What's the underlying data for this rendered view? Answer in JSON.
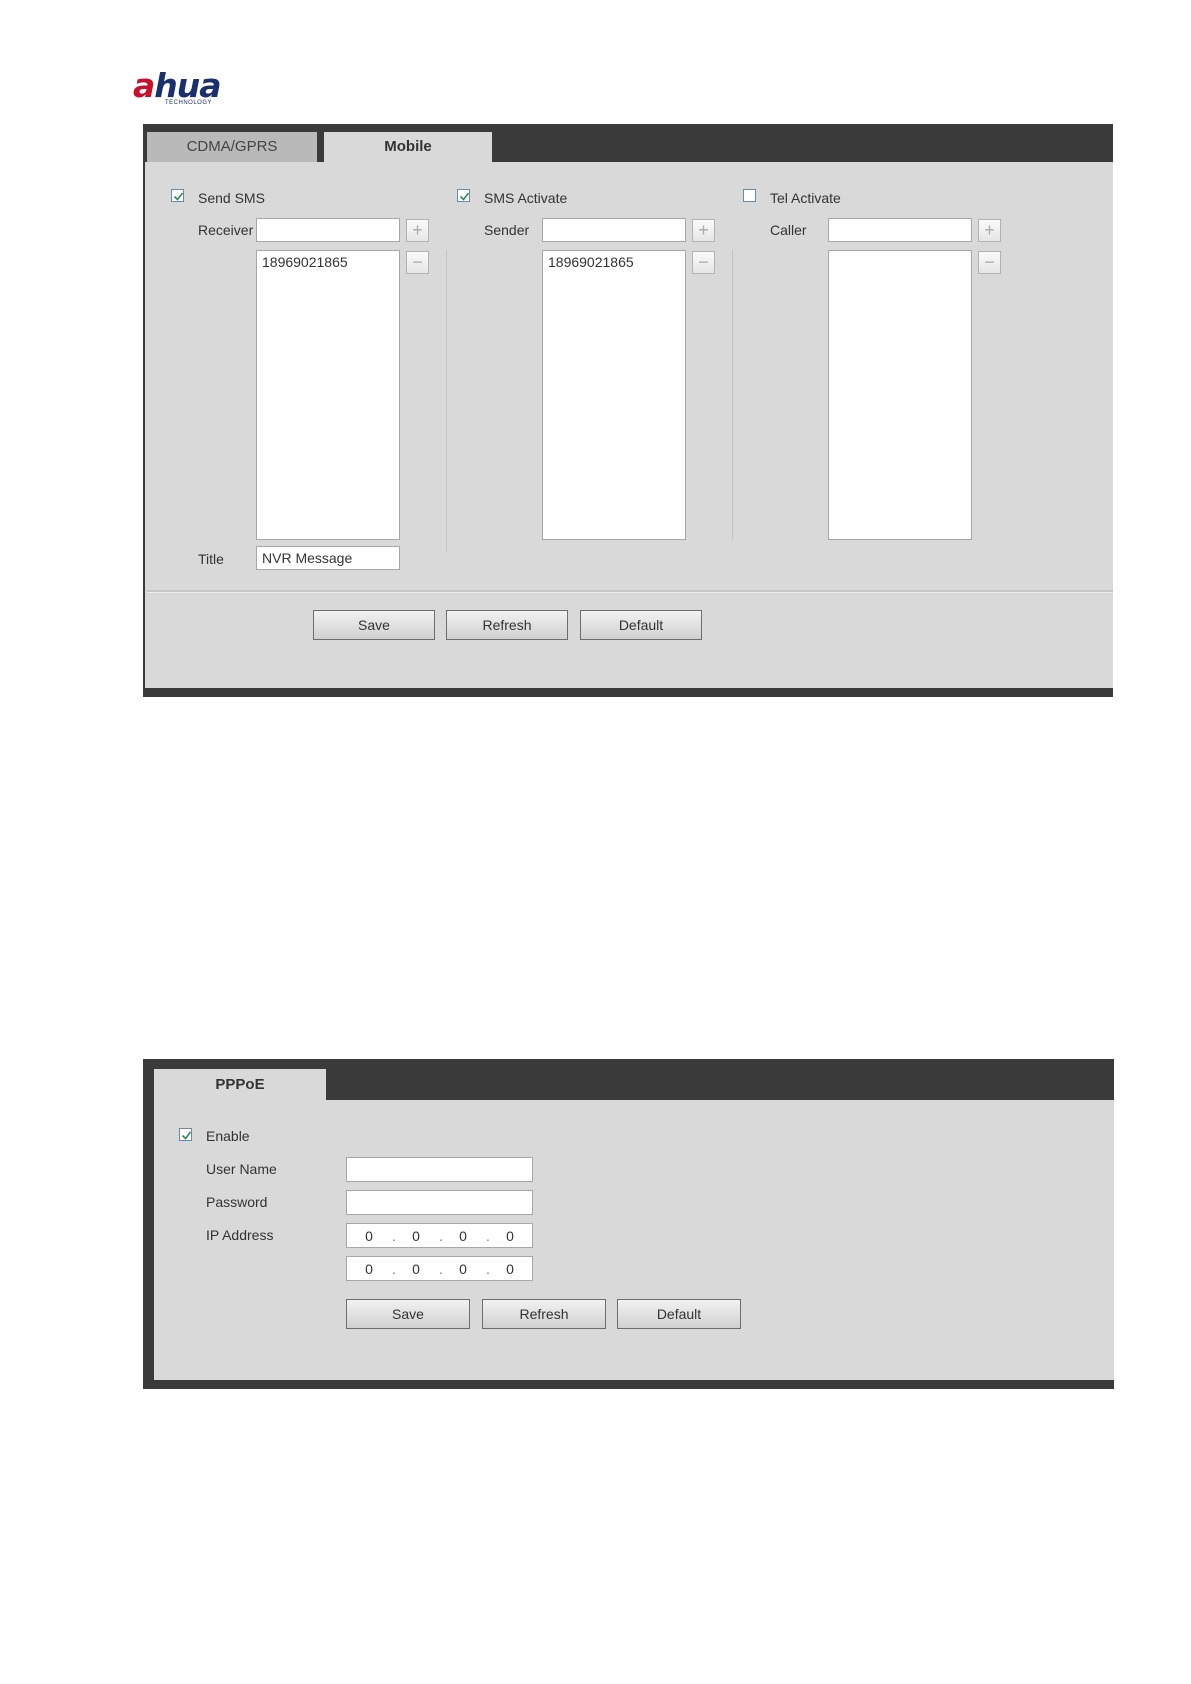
{
  "logo": {
    "main_pre": "a",
    "main_post": "hua",
    "sub": "TECHNOLOGY"
  },
  "mobile_panel": {
    "tabs": [
      {
        "label": "CDMA/GPRS",
        "active": false
      },
      {
        "label": "Mobile",
        "active": true
      }
    ],
    "columns": [
      {
        "checkbox_label": "Send SMS",
        "checked": true,
        "field_label": "Receiver",
        "field_value": "",
        "list_items": [
          "18969021865"
        ],
        "title_label": "Title",
        "title_value": "NVR Message"
      },
      {
        "checkbox_label": "SMS Activate",
        "checked": true,
        "field_label": "Sender",
        "field_value": "",
        "list_items": [
          "18969021865"
        ]
      },
      {
        "checkbox_label": "Tel Activate",
        "checked": false,
        "field_label": "Caller",
        "field_value": "",
        "list_items": []
      }
    ],
    "buttons": {
      "save": "Save",
      "refresh": "Refresh",
      "default": "Default"
    },
    "add_symbol": "+",
    "remove_symbol": "−"
  },
  "pppoe_panel": {
    "tab": "PPPoE",
    "enable_label": "Enable",
    "enable_checked": true,
    "username_label": "User Name",
    "username_value": "",
    "password_label": "Password",
    "password_value": "",
    "ip_label": "IP Address",
    "ip_rows": [
      {
        "octets": [
          "0",
          "0",
          "0",
          "0"
        ]
      },
      {
        "octets": [
          "0",
          "0",
          "0",
          "0"
        ]
      }
    ],
    "buttons": {
      "save": "Save",
      "refresh": "Refresh",
      "default": "Default"
    }
  },
  "colors": {
    "frame": "#3a3a3a",
    "panel": "#d9d9d9",
    "inactive_tab": "#b9b9b9",
    "checkmark": "#2e8b57",
    "logo_red": "#c8102e",
    "logo_blue": "#1a2f6e"
  }
}
